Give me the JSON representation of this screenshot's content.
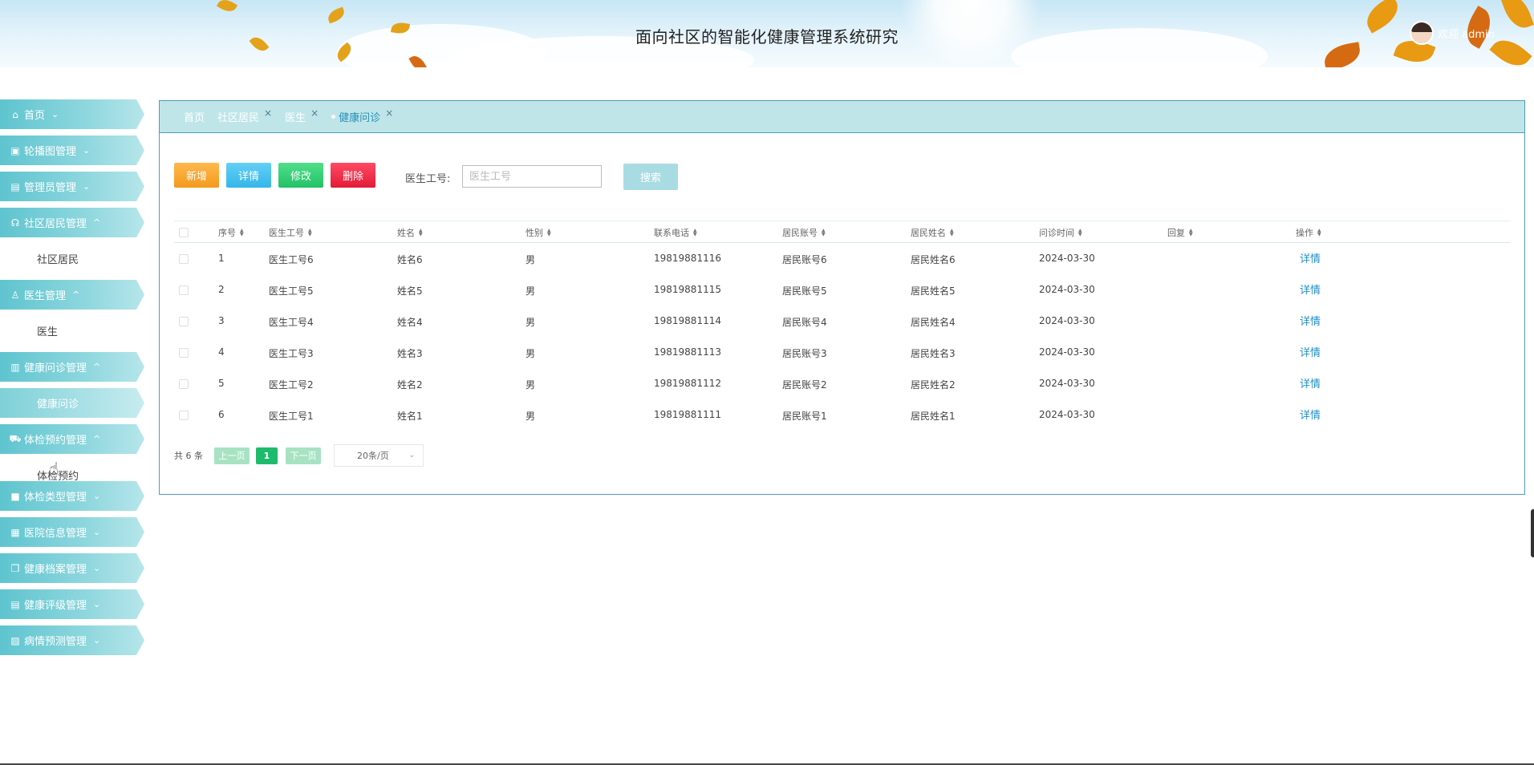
{
  "header": {
    "title": "面向社区的智能化健康管理系统研究",
    "welcome": "欢迎 admin"
  },
  "sidebar": {
    "menus": [
      {
        "label": "首页",
        "icon": "home-icon",
        "expanded": false
      },
      {
        "label": "轮播图管理",
        "icon": "image-icon",
        "expanded": false
      },
      {
        "label": "管理员管理",
        "icon": "admin-icon",
        "expanded": false
      },
      {
        "label": "社区居民管理",
        "icon": "headset-icon",
        "expanded": true,
        "sub": "社区居民"
      },
      {
        "label": "医生管理",
        "icon": "user-icon",
        "expanded": true,
        "sub": "医生"
      },
      {
        "label": "健康问诊管理",
        "icon": "doc-icon",
        "expanded": true,
        "sub": "健康问诊"
      },
      {
        "label": "体检预约管理",
        "icon": "car-icon",
        "expanded": true,
        "sub": "体检预约"
      },
      {
        "label": "体检类型管理",
        "icon": "box-icon",
        "expanded": false
      },
      {
        "label": "医院信息管理",
        "icon": "grid-icon",
        "expanded": false
      },
      {
        "label": "健康档案管理",
        "icon": "copy-icon",
        "expanded": false
      },
      {
        "label": "健康评级管理",
        "icon": "table-icon",
        "expanded": false
      },
      {
        "label": "病情预测管理",
        "icon": "chart-icon",
        "expanded": false
      }
    ]
  },
  "tabs": [
    {
      "label": "首页",
      "closable": false
    },
    {
      "label": "社区居民",
      "closable": true
    },
    {
      "label": "医生",
      "closable": true
    },
    {
      "label": "健康问诊",
      "closable": true,
      "active": true
    }
  ],
  "toolbar": {
    "add": "新增",
    "detail": "详情",
    "edit": "修改",
    "delete": "删除",
    "search_label": "医生工号:",
    "search_placeholder": "医生工号",
    "search_button": "搜索"
  },
  "table": {
    "columns": [
      "序号",
      "医生工号",
      "姓名",
      "性别",
      "联系电话",
      "居民账号",
      "居民姓名",
      "问诊时间",
      "回复",
      "操作"
    ],
    "rows": [
      [
        "1",
        "医生工号6",
        "姓名6",
        "男",
        "19819881116",
        "居民账号6",
        "居民姓名6",
        "2024-03-30",
        "",
        "详情"
      ],
      [
        "2",
        "医生工号5",
        "姓名5",
        "男",
        "19819881115",
        "居民账号5",
        "居民姓名5",
        "2024-03-30",
        "",
        "详情"
      ],
      [
        "3",
        "医生工号4",
        "姓名4",
        "男",
        "19819881114",
        "居民账号4",
        "居民姓名4",
        "2024-03-30",
        "",
        "详情"
      ],
      [
        "4",
        "医生工号3",
        "姓名3",
        "男",
        "19819881113",
        "居民账号3",
        "居民姓名3",
        "2024-03-30",
        "",
        "详情"
      ],
      [
        "5",
        "医生工号2",
        "姓名2",
        "男",
        "19819881112",
        "居民账号2",
        "居民姓名2",
        "2024-03-30",
        "",
        "详情"
      ],
      [
        "6",
        "医生工号1",
        "姓名1",
        "男",
        "19819881111",
        "居民账号1",
        "居民姓名1",
        "2024-03-30",
        "",
        "详情"
      ]
    ]
  },
  "pagination": {
    "total": "共 6 条",
    "prev": "上一页",
    "current": "1",
    "next": "下一页",
    "page_size": "20条/页"
  },
  "colors": {
    "accent": "#5ec4cf",
    "panel_border": "#4e9cb6",
    "tab_bar": "#bfe5e9",
    "link": "#1f8fc7",
    "add": "#f39a1c",
    "detail": "#34b6ea",
    "edit": "#23c266",
    "delete": "#e21b38"
  }
}
